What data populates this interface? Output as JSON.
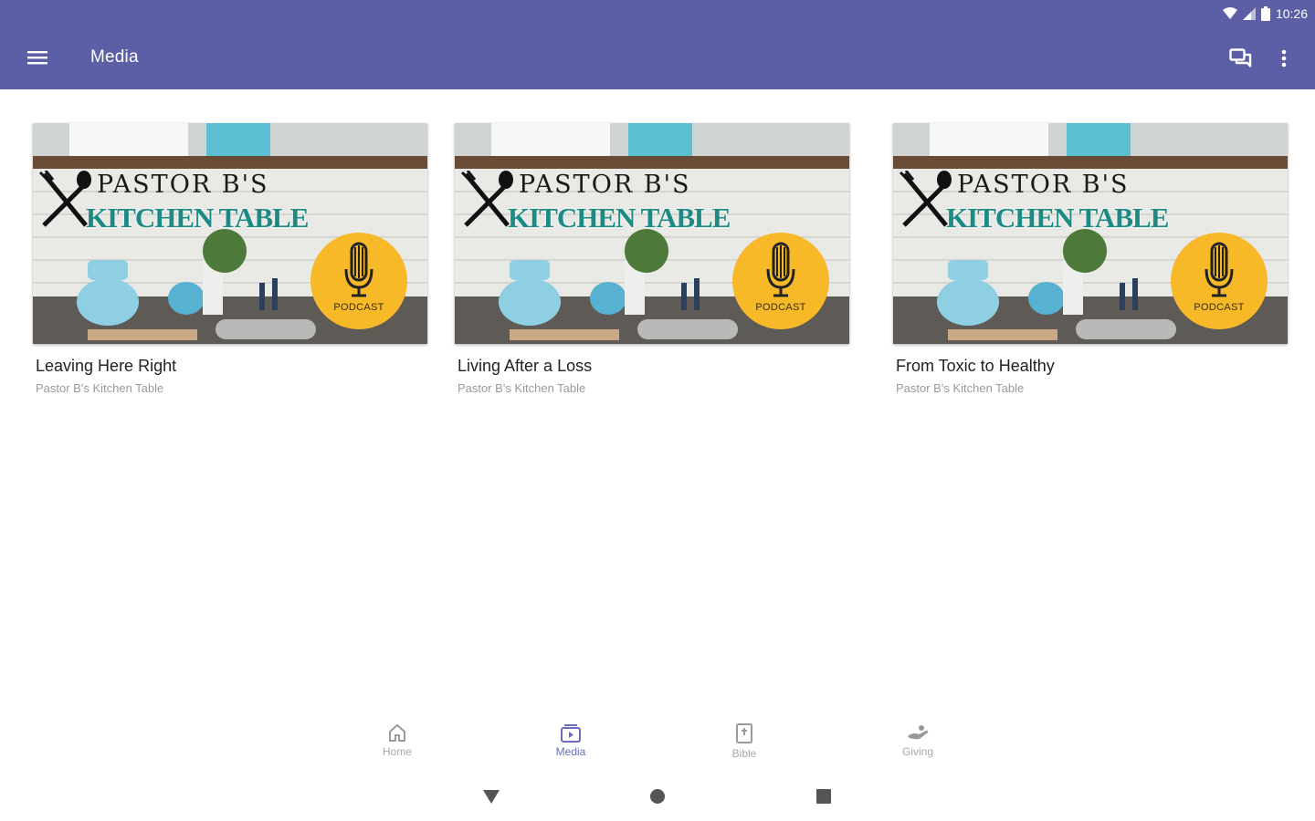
{
  "status_bar": {
    "time": "10:26"
  },
  "app_bar": {
    "title": "Media"
  },
  "thumbnail": {
    "logo_line1": "PASTOR B'S",
    "logo_line2": "KITCHEN TABLE",
    "badge_label": "PODCAST"
  },
  "cards": [
    {
      "title": "Leaving Here Right",
      "subtitle": "Pastor B's Kitchen Table"
    },
    {
      "title": "Living After a Loss",
      "subtitle": "Pastor B's Kitchen Table"
    },
    {
      "title": "From Toxic to Healthy",
      "subtitle": "Pastor B's Kitchen Table"
    }
  ],
  "bottom_nav": [
    {
      "label": "Home",
      "icon": "home-icon"
    },
    {
      "label": "Media",
      "icon": "media-icon",
      "active": true
    },
    {
      "label": "Bible",
      "icon": "bible-icon"
    },
    {
      "label": "Giving",
      "icon": "giving-icon"
    }
  ],
  "colors": {
    "app_bar": "#5d5fa6",
    "active_nav": "#6a6cc0",
    "badge": "#f7b928",
    "logo_teal": "#1e8a84"
  }
}
